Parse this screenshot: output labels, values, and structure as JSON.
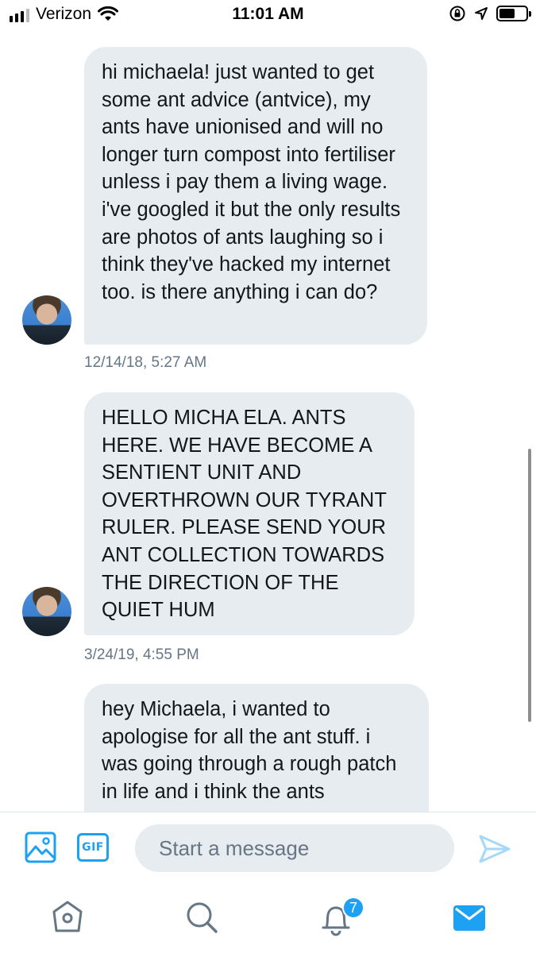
{
  "status_bar": {
    "carrier": "Verizon",
    "time": "11:01 AM",
    "battery_level": 0.58
  },
  "messages": [
    {
      "text": "hi michaela! just wanted to get some ant advice (antvice), my ants have unionised and will no longer turn compost into fertiliser unless i pay them a living wage. i've googled it but the only results are photos of ants laughing so i think they've hacked my internet too. is there anything i can do?",
      "timestamp": "12/14/18, 5:27 AM"
    },
    {
      "text": "HELLO MICHA ELA. ANTS HERE. WE HAVE BECOME A SENTIENT UNIT AND OVERTHROWN OUR TYRANT RULER. PLEASE SEND YOUR ANT COLLECTION TOWARDS THE DIRECTION OF THE QUIET HUM",
      "timestamp": "3/24/19, 4:55 PM"
    },
    {
      "text": "hey Michaela, i wanted to apologise for all the ant stuff. i was going through a rough patch in life and i think the ants",
      "timestamp": ""
    }
  ],
  "composer": {
    "gif_label": "GIF",
    "placeholder": "Start a message"
  },
  "tab_bar": {
    "notifications_badge": "7"
  },
  "colors": {
    "accent": "#1da1f2",
    "bubble": "#e6ecf0",
    "timestamp": "#657786"
  }
}
